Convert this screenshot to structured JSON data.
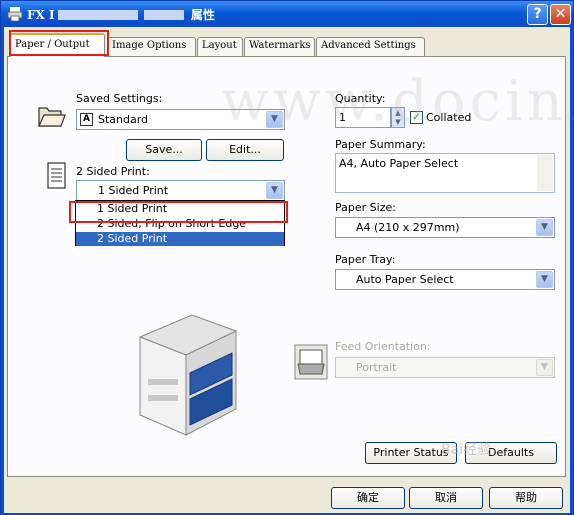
{
  "window": {
    "title_prefix": "FX I",
    "title_suffix": "属性",
    "help_label": "?",
    "close_label": "✕"
  },
  "tabs": [
    {
      "label": "Paper / Output",
      "active": true
    },
    {
      "label": "Image Options"
    },
    {
      "label": "Layout"
    },
    {
      "label": "Watermarks"
    },
    {
      "label": "Advanced Settings"
    }
  ],
  "saved_settings": {
    "label": "Saved Settings:",
    "value": "Standard",
    "value_icon": "A",
    "save_label": "Save...",
    "edit_label": "Edit..."
  },
  "two_sided": {
    "label": "2 Sided Print:",
    "value": "1 Sided Print",
    "options": [
      "1 Sided Print",
      "2 Sided, Flip on Short Edge",
      "2 Sided Print"
    ],
    "selected_index": 2
  },
  "quantity": {
    "label": "Quantity:",
    "value": "1",
    "collated_label": "Collated",
    "collated_checked": true
  },
  "paper_summary": {
    "label": "Paper Summary:",
    "value": "A4, Auto Paper Select"
  },
  "paper_size": {
    "label": "Paper Size:",
    "value": "A4 (210 x 297mm)"
  },
  "paper_tray": {
    "label": "Paper Tray:",
    "value": "Auto Paper Select"
  },
  "feed_orientation": {
    "label": "Feed Orientation:",
    "value": "Portrait"
  },
  "buttons": {
    "printer_status": "Printer Status",
    "defaults": "Defaults",
    "ok": "确定",
    "cancel": "取消",
    "help": "帮助"
  },
  "watermark": "www.docin.co",
  "baidu_watermark": "Bai经验",
  "colors": {
    "highlight": "#316ac5",
    "annotation_red": "#e0201a",
    "title_bar": "#0b5ad8"
  }
}
